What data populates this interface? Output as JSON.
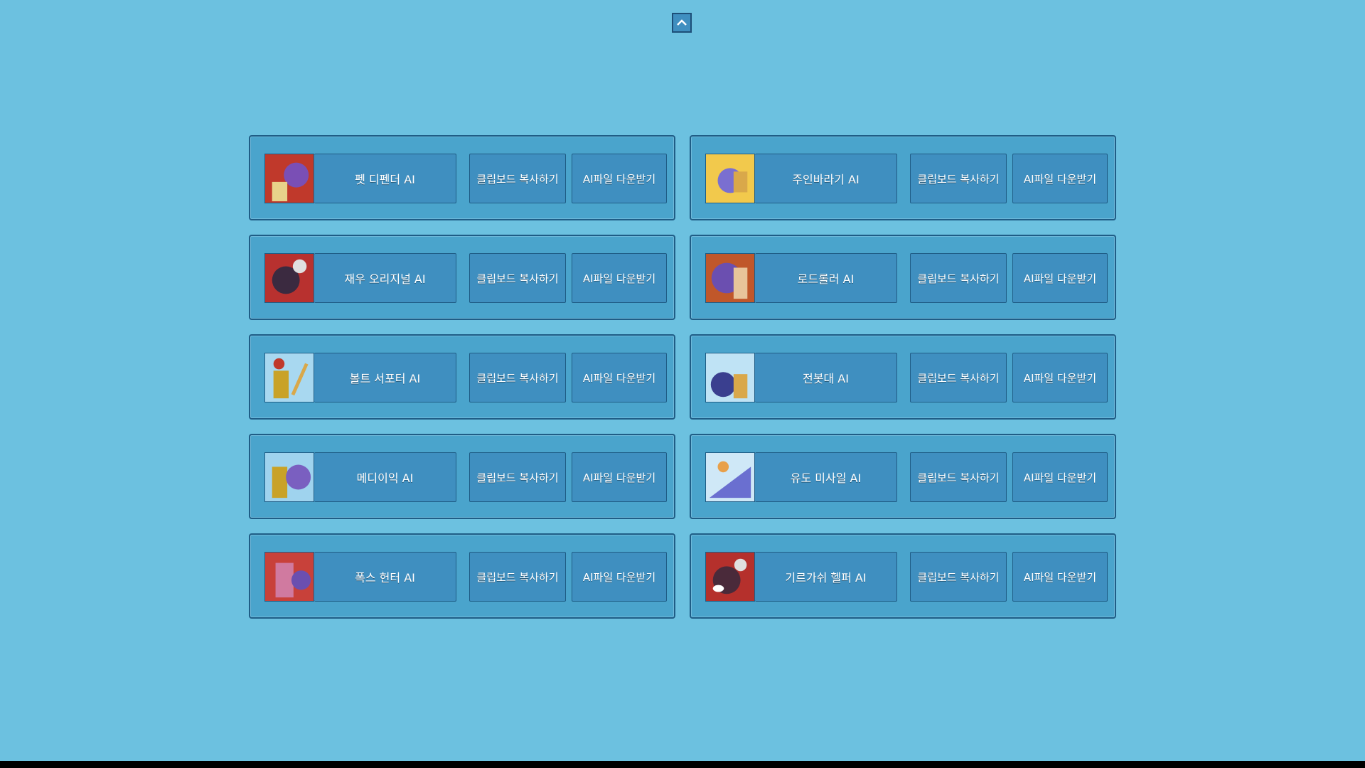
{
  "scroll_top_icon": "chevron-up-icon",
  "copy_label": "클립보드 복사하기",
  "download_label": "AI파일 다운받기",
  "cards": [
    {
      "name": "펫 디펜더 AI",
      "thumb_bg": "#c0392b",
      "thumb_fg": "#7a4fb5"
    },
    {
      "name": "주인바라기 AI",
      "thumb_bg": "#f2c94c",
      "thumb_fg": "#7a6fd0"
    },
    {
      "name": "재우 오리지널 AI",
      "thumb_bg": "#b8312f",
      "thumb_fg": "#3b2a40"
    },
    {
      "name": "로드롤러 AI",
      "thumb_bg": "#c0572a",
      "thumb_fg": "#6b4fb0"
    },
    {
      "name": "볼트 서포터 AI",
      "thumb_bg": "#a8d8f0",
      "thumb_fg": "#c9a227"
    },
    {
      "name": "전봇대 AI",
      "thumb_bg": "#bfe3f5",
      "thumb_fg": "#3a3f8f"
    },
    {
      "name": "메디이익 AI",
      "thumb_bg": "#9fd3ee",
      "thumb_fg": "#7a5fc0"
    },
    {
      "name": "유도 미사일 AI",
      "thumb_bg": "#cfe8f7",
      "thumb_fg": "#6a6fd0"
    },
    {
      "name": "폭스 헌터 AI",
      "thumb_bg": "#c8413a",
      "thumb_fg": "#d07aa0"
    },
    {
      "name": "기르가쉬 헬퍼 AI",
      "thumb_bg": "#b5302c",
      "thumb_fg": "#4a2a3a"
    }
  ]
}
